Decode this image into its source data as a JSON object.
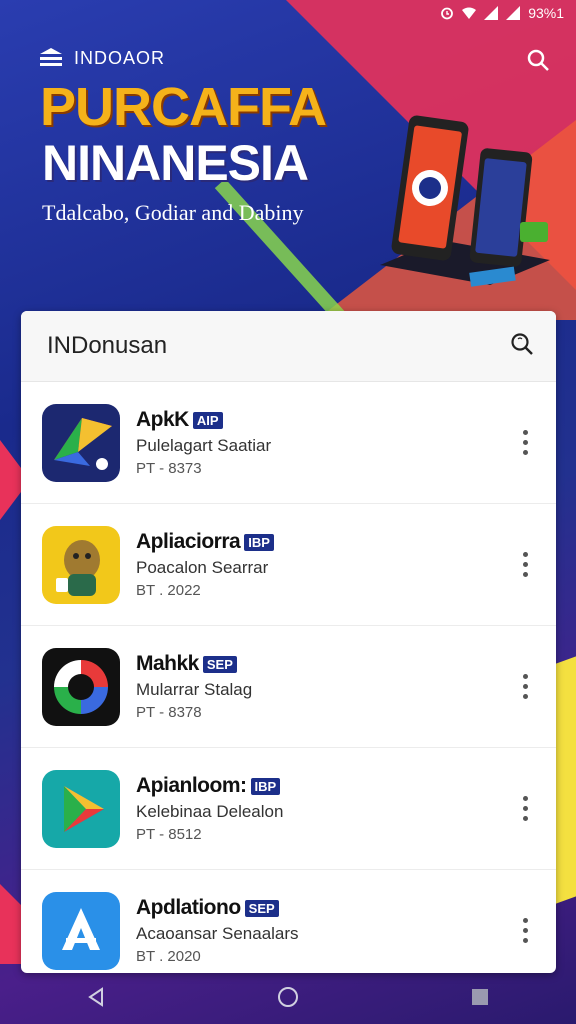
{
  "status_bar": {
    "battery": "93%1"
  },
  "header": {
    "brand": "INDOAOR",
    "title_line1": "PURCAFFA",
    "title_line2": "NINANESIA",
    "subtitle": "Tdalcabo, Godiar and Dabiny"
  },
  "card": {
    "title": "INDonusan",
    "apps": [
      {
        "name": "ApkK",
        "badge": "AIP",
        "desc": "Pulelagart Saatiar",
        "meta": "PT - 8373",
        "icon": "kite-icon"
      },
      {
        "name": "Apliaciorra",
        "badge": "IBP",
        "desc": "Poacalon Searrar",
        "meta": "BT . 2022",
        "icon": "mascot-icon"
      },
      {
        "name": "Mahkk",
        "badge": "SEP",
        "desc": "Mularrar Stalag",
        "meta": "PT - 8378",
        "icon": "ring-icon"
      },
      {
        "name": "Apianloom:",
        "badge": "IBP",
        "desc": "Kelebinaa Delealon",
        "meta": "PT - 8512",
        "icon": "play-icon"
      },
      {
        "name": "Apdlationo",
        "badge": "SEP",
        "desc": "Acaoansar Senaalars",
        "meta": "BT . 2020",
        "icon": "appstore-icon"
      }
    ]
  },
  "colors": {
    "brand_blue": "#1c2f8a",
    "title_yellow": "#f5b21a"
  }
}
